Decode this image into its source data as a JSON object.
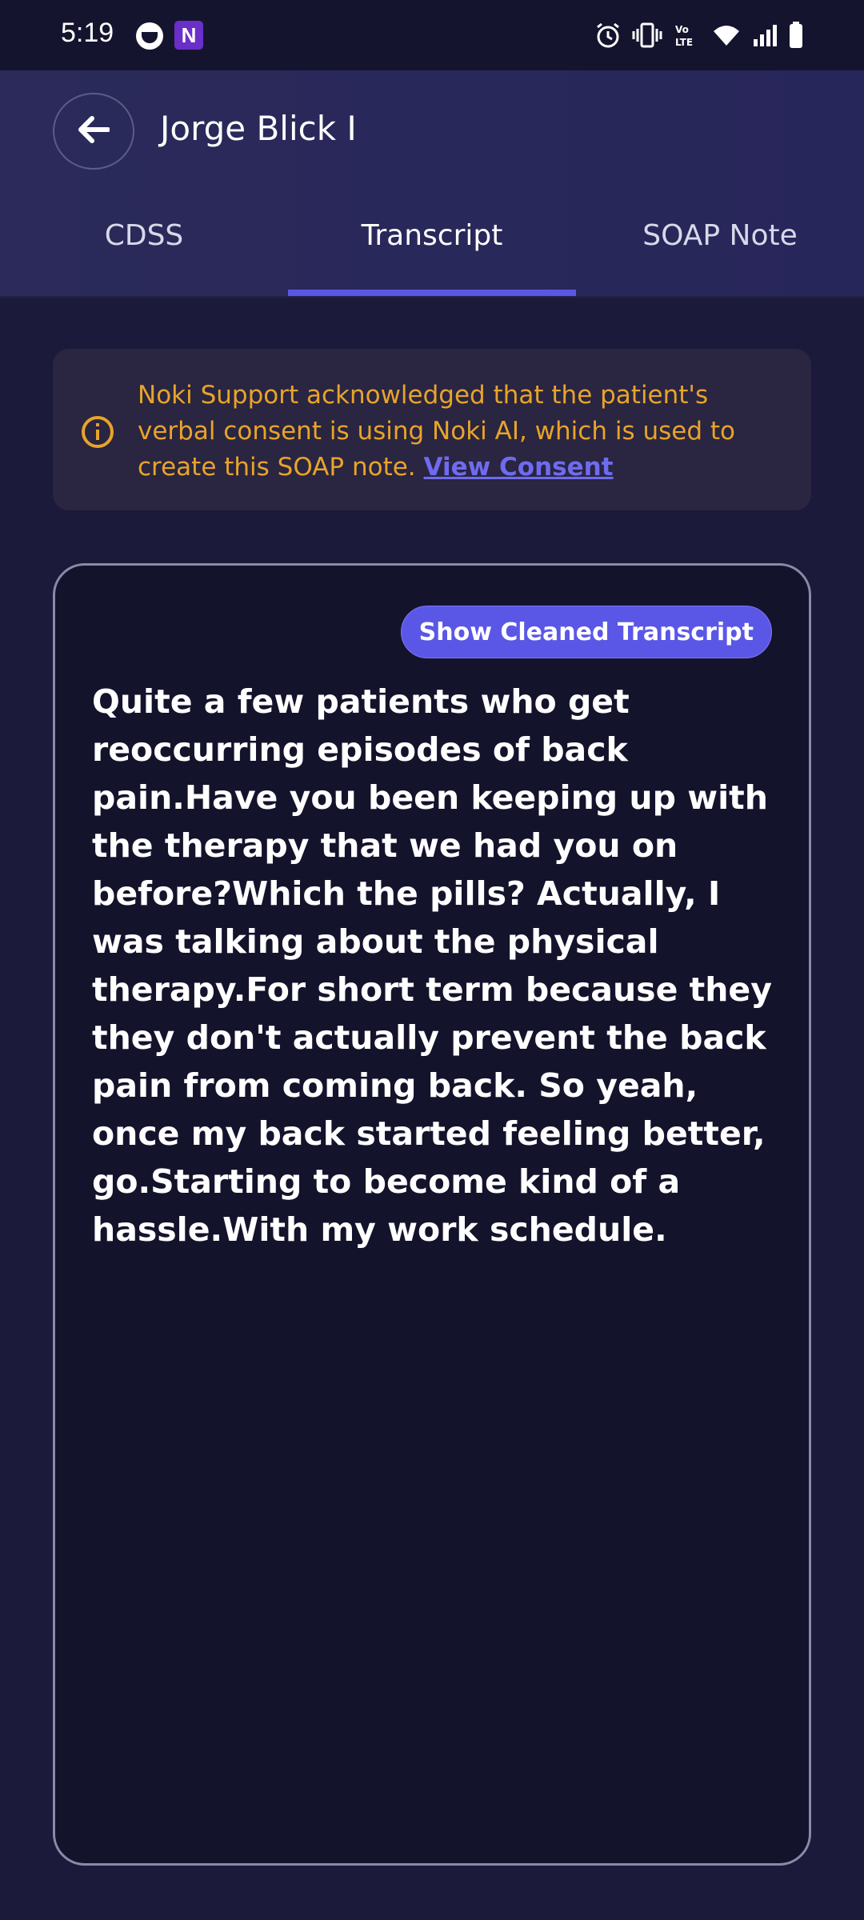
{
  "status_bar": {
    "time": "5:19",
    "app_icons": [
      "face-icon",
      "noki-app-icon"
    ],
    "noki_glyph": "N",
    "right_icons": [
      "alarm-icon",
      "vibrate-icon",
      "volte-icon",
      "wifi-icon",
      "signal-icon",
      "battery-icon"
    ]
  },
  "header": {
    "title": "Jorge Blick I",
    "back_icon": "arrow-left-icon"
  },
  "tabs": [
    {
      "label": "CDSS",
      "active": false
    },
    {
      "label": "Transcript",
      "active": true
    },
    {
      "label": "SOAP Note",
      "active": false
    }
  ],
  "consent": {
    "icon": "info-icon",
    "text": "Noki Support acknowledged that the patient's verbal consent is using Noki AI, which is used to create this SOAP note.",
    "link_label": "View Consent"
  },
  "transcript": {
    "toggle_label": "Show Cleaned Transcript",
    "body": "Quite a few patients who get reoccurring episodes of back pain.Have you been keeping up with the therapy that we had you on before?Which the pills? Actually, I was talking about the physical therapy.For short term because they they don't actually prevent the back pain from coming back. So yeah, once my back started feeling better, go.Starting to become kind of a hassle.With my work schedule."
  },
  "colors": {
    "accent": "#5b57e6",
    "consent_text": "#e8a42a",
    "background": "#1b1a3a"
  }
}
